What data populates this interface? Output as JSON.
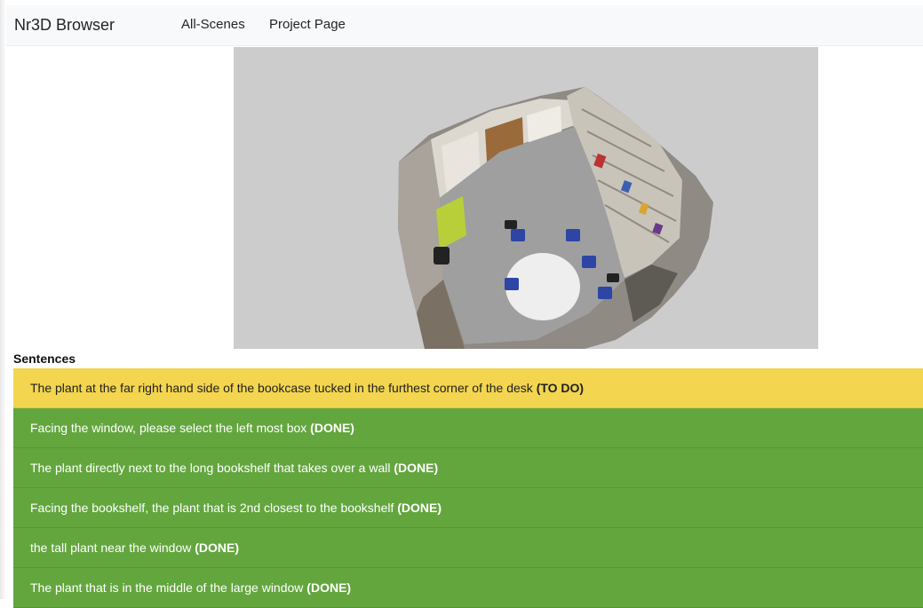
{
  "navbar": {
    "brand": "Nr3D Browser",
    "links": [
      "All-Scenes",
      "Project Page"
    ]
  },
  "viewer": {
    "background": "#cccccc"
  },
  "sentences": {
    "title": "Sentences",
    "items": [
      {
        "text": "The plant at the far right hand side of the bookcase tucked in the furthest corner of the desk",
        "status": "(TO DO)"
      },
      {
        "text": "Facing the window, please select the left most box",
        "status": "(DONE)"
      },
      {
        "text": "The plant directly next to the long bookshelf that takes over a wall",
        "status": "(DONE)"
      },
      {
        "text": "Facing the bookshelf, the plant that is 2nd closest to the bookshelf",
        "status": "(DONE)"
      },
      {
        "text": "the tall plant near the window",
        "status": "(DONE)"
      },
      {
        "text": "The plant that is in the middle of the large window",
        "status": "(DONE)"
      }
    ]
  },
  "colors": {
    "todo": "#f3d54f",
    "done": "#63a63e",
    "navbar": "#f8f9fa"
  }
}
